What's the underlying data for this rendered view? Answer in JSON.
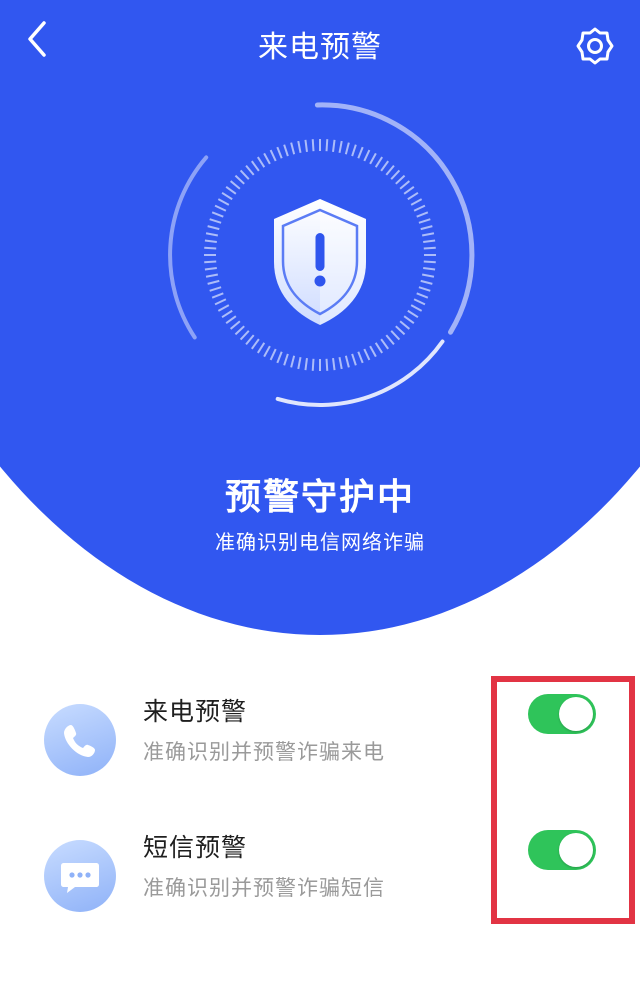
{
  "header": {
    "title": "来电预警",
    "back_icon": "chevron-left-icon",
    "settings_icon": "gear-icon"
  },
  "hero": {
    "status_title": "预警守护中",
    "status_subtitle": "准确识别电信网络诈骗",
    "emblem_icon": "shield-exclamation-icon"
  },
  "settings": [
    {
      "title": "来电预警",
      "description": "准确识别并预警诈骗来电",
      "icon": "phone-icon",
      "enabled": true
    },
    {
      "title": "短信预警",
      "description": "准确识别并预警诈骗短信",
      "icon": "message-icon",
      "enabled": true
    }
  ],
  "colors": {
    "primary_blue": "#3157f0",
    "toggle_on": "#2fc45a",
    "highlight_red": "#e23444",
    "subtext_gray": "#9a9a9a"
  }
}
